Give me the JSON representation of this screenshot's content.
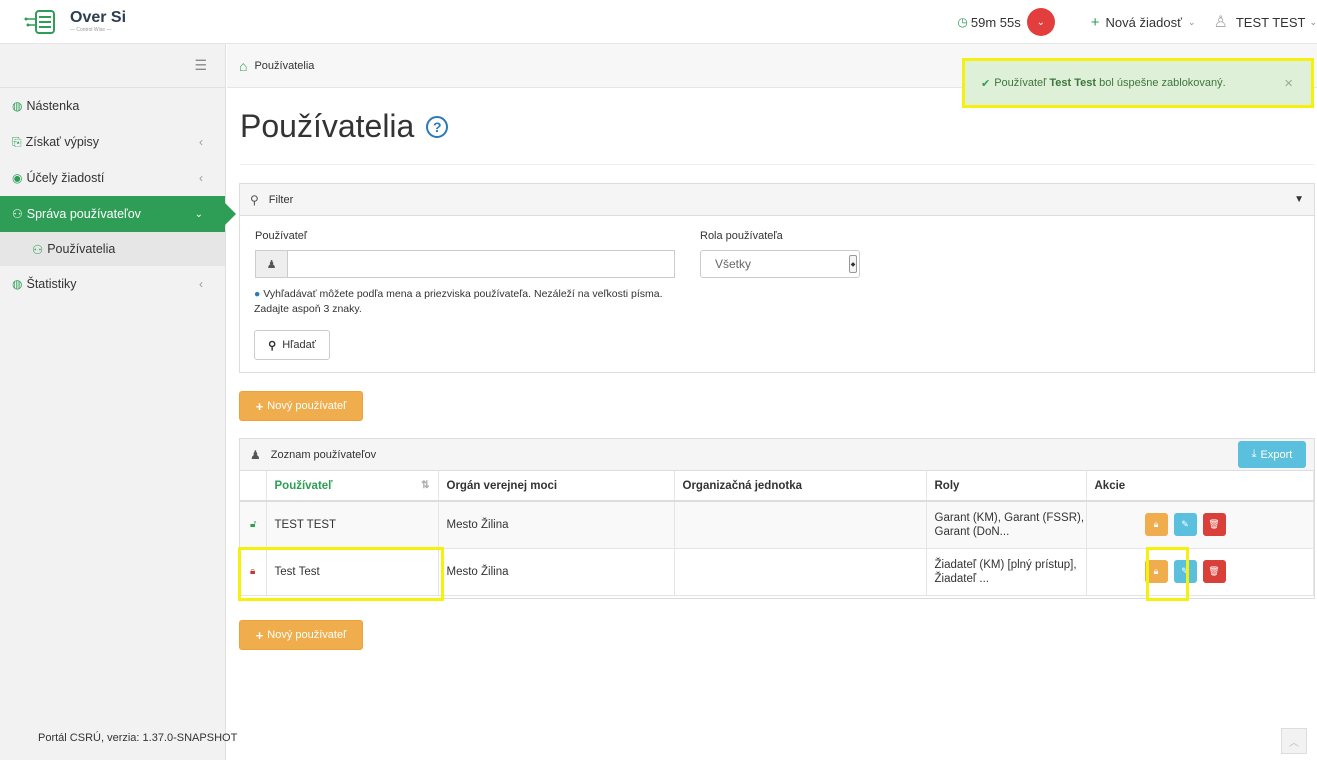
{
  "app": {
    "logo_title": "Over Si",
    "logo_sub": "— Control Wise —"
  },
  "header": {
    "timer": "59m 55s",
    "new_request": "Nová žiadosť",
    "user": "TEST TEST"
  },
  "sidebar": {
    "items": [
      {
        "label": "Nástenka"
      },
      {
        "label": "Získať výpisy"
      },
      {
        "label": "Účely žiadostí"
      },
      {
        "label": "Správa používateľov"
      },
      {
        "label": "Používatelia"
      },
      {
        "label": "Štatistiky"
      }
    ],
    "footer": "Portál CSRÚ, verzia: 1.37.0-SNAPSHOT"
  },
  "breadcrumb": {
    "current": "Používatelia"
  },
  "toast": {
    "prefix": "Používateľ ",
    "name": "Test Test",
    "suffix": " bol úspešne zablokovaný."
  },
  "page": {
    "title": "Používatelia",
    "help": "?"
  },
  "filter": {
    "title": "Filter",
    "user_label": "Používateľ",
    "user_value": "",
    "role_label": "Rola používateľa",
    "role_selected": "Všetky",
    "help": "Vyhľadávať môžete podľa mena a priezviska používateľa. Nezáleží na veľkosti písma. Zadajte aspoň 3 znaky.",
    "search_btn": "Hľadať"
  },
  "new_user_btn": "Nový používateľ",
  "list": {
    "title": "Zoznam používateľov",
    "export_btn": "Export",
    "columns": [
      "Používateľ",
      "Orgán verejnej moci",
      "Organizačná jednotka",
      "Roly",
      "Akcie"
    ],
    "rows": [
      {
        "user": "TEST TEST",
        "authority": "Mesto Žilina",
        "unit": "",
        "roles": "Garant (KM), Garant (FSSR), Garant (DoN...",
        "locked": false
      },
      {
        "user": "Test Test",
        "authority": "Mesto Žilina",
        "unit": "",
        "roles": "Žiadateľ (KM) [plný prístup], Žiadateľ ...",
        "locked": true
      }
    ]
  },
  "colors": {
    "primary": "#2e9e57",
    "warning": "#f0ad4e",
    "info": "#5bc0de",
    "danger": "#d9403a",
    "highlight": "#f5f10d"
  }
}
